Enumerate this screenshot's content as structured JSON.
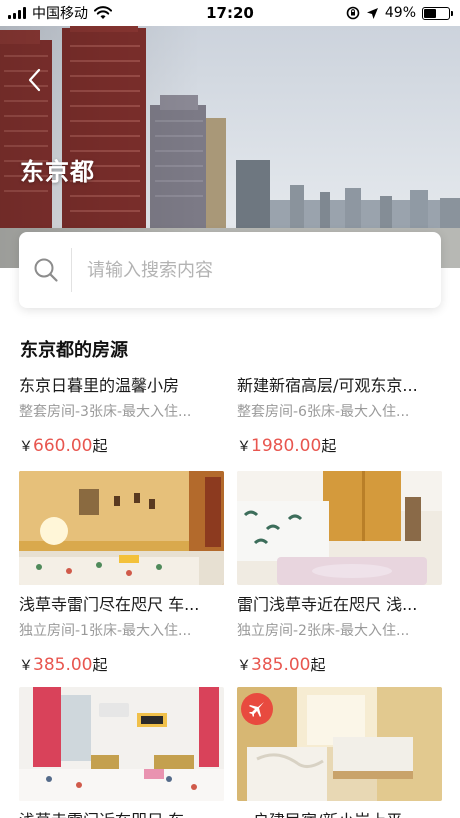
{
  "status_bar": {
    "carrier": "中国移动",
    "time": "17:20",
    "battery": "49%",
    "battery_level": 0.49,
    "icons": [
      "signal-icon",
      "wifi-icon",
      "rotation-lock-icon",
      "location-icon",
      "battery-icon"
    ]
  },
  "header": {
    "back_icon": "chevron-left-icon",
    "title": "东京都"
  },
  "search": {
    "placeholder": "请输入搜索内容",
    "icon": "search-icon"
  },
  "section": {
    "title": "东京都的房源"
  },
  "listings": [
    {
      "title": "东京日暮里的温馨小房",
      "subtitle": "整套房间-3张床-最大入住...",
      "currency": "￥",
      "price": "660.00",
      "suffix": "起"
    },
    {
      "title": "新建新宿高层/可观东京...",
      "subtitle": "整套房间-6张床-最大入住...",
      "currency": "￥",
      "price": "1980.00",
      "suffix": "起"
    },
    {
      "title": "浅草寺雷门尽在咫尺 车...",
      "subtitle": "独立房间-1张床-最大入住...",
      "currency": "￥",
      "price": "385.00",
      "suffix": "起"
    },
    {
      "title": "雷门浅草寺近在咫尺 浅...",
      "subtitle": "独立房间-2张床-最大入住...",
      "currency": "￥",
      "price": "385.00",
      "suffix": "起"
    },
    {
      "title": "浅草寺雷门近在咫尺 车...",
      "subtitle": "",
      "currency": "",
      "price": "",
      "suffix": ""
    },
    {
      "title": "一户建民宿/新小岩上平...",
      "subtitle": "",
      "currency": "",
      "price": "",
      "suffix": "",
      "badge_icon": "airplane-icon"
    }
  ],
  "colors": {
    "accent_price": "#e8564f",
    "badge": "#e84a3f",
    "text_primary": "#1a1a1a",
    "text_secondary": "#9a9a9a"
  }
}
